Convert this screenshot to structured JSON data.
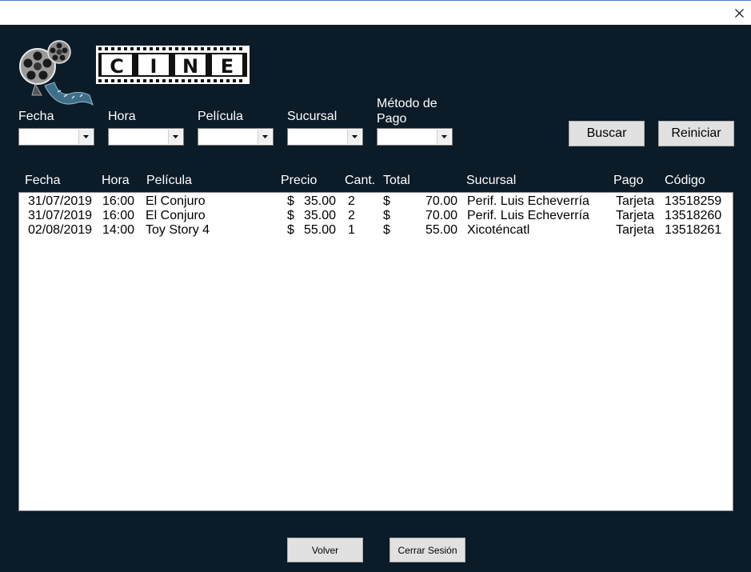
{
  "window": {
    "close_icon": "close-icon"
  },
  "logo": {
    "text": "CINE",
    "reel_icon": "film-reel-icon"
  },
  "filters": [
    {
      "label": "Fecha",
      "value": ""
    },
    {
      "label": "Hora",
      "value": ""
    },
    {
      "label": "Película",
      "value": ""
    },
    {
      "label": "Sucursal",
      "value": ""
    },
    {
      "label_line1": "Método de",
      "label_line2": "Pago",
      "value": ""
    }
  ],
  "buttons": {
    "search": "Buscar",
    "reset": "Reiniciar",
    "back": "Volver",
    "logout": "Cerrar Sesión"
  },
  "columns": [
    "Fecha",
    "Hora",
    "Película",
    "Precio",
    "Cant.",
    "Total",
    "Sucursal",
    "Pago",
    "Código"
  ],
  "rows": [
    {
      "fecha": "31/07/2019",
      "hora": "16:00",
      "pelicula": "El Conjuro",
      "precio_symbol": "$",
      "precio": "35.00",
      "cant": "2",
      "total_symbol": "$",
      "total": "70.00",
      "sucursal": "Perif. Luis Echeverría",
      "pago": "Tarjeta",
      "codigo": "13518259"
    },
    {
      "fecha": "31/07/2019",
      "hora": "16:00",
      "pelicula": "El Conjuro",
      "precio_symbol": "$",
      "precio": "35.00",
      "cant": "2",
      "total_symbol": "$",
      "total": "70.00",
      "sucursal": "Perif. Luis Echeverría",
      "pago": "Tarjeta",
      "codigo": "13518260"
    },
    {
      "fecha": "02/08/2019",
      "hora": "14:00",
      "pelicula": "Toy Story 4",
      "precio_symbol": "$",
      "precio": "55.00",
      "cant": "1",
      "total_symbol": "$",
      "total": "55.00",
      "sucursal": "Xicoténcatl",
      "pago": "Tarjeta",
      "codigo": "13518261"
    }
  ],
  "colors": {
    "background": "#0b1b28",
    "list_background": "#ffffff",
    "button_face": "#e1e1e1"
  }
}
